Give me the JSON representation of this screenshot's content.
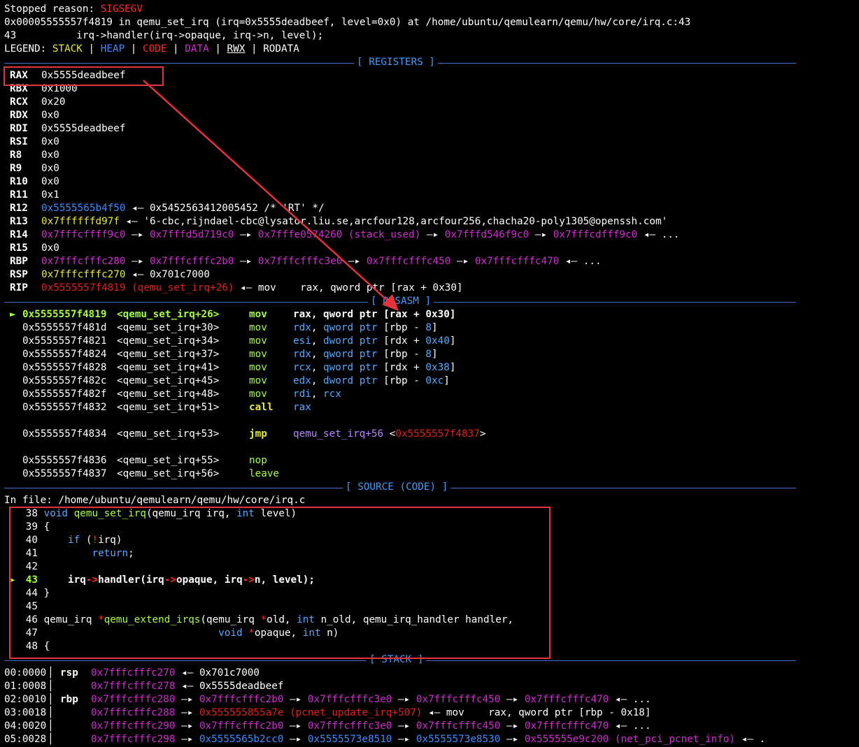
{
  "header": {
    "stopped_label": "Stopped reason: ",
    "stopped_reason": "SIGSEGV",
    "location_line": "0x00005555557f4819 in qemu_set_irq (irq=0x5555deadbeef, level=0x0) at /home/ubuntu/qemulearn/qemu/hw/core/irq.c:43",
    "source_line": "43          irq->handler(irq->opaque, irq->n, level);",
    "legend": {
      "label": "LEGEND: ",
      "stack": "STACK",
      "heap": "HEAP",
      "code": "CODE",
      "data": "DATA",
      "rwx": "RWX",
      "rodata": "RODATA",
      "sep": " | "
    }
  },
  "sections": {
    "registers": "[ REGISTERS ]",
    "disasm": "[ DISASM ]",
    "source": "[ SOURCE (CODE) ]",
    "stack": "[ STACK ]"
  },
  "registers": [
    {
      "name": "RAX",
      "value": "0x5555deadbeef"
    },
    {
      "name": "RBX",
      "value": "0x1000"
    },
    {
      "name": "RCX",
      "value": "0x20"
    },
    {
      "name": "RDX",
      "value": "0x0"
    },
    {
      "name": "RDI",
      "value": "0x5555deadbeef"
    },
    {
      "name": "RSI",
      "value": "0x0"
    },
    {
      "name": "R8",
      "value": "0x0"
    },
    {
      "name": "R9",
      "value": "0x0"
    },
    {
      "name": "R10",
      "value": "0x0"
    },
    {
      "name": "R11",
      "value": "0x1"
    },
    {
      "name": "R12",
      "p1": "0x5555565b4f50",
      "p2": " ◂— 0x5452563412005452 /* 'RT' */"
    },
    {
      "name": "R13",
      "p1": "0x7ffffffd97f",
      "p2": " ◂— '6-cbc,rijndael-cbc@lysator.liu.se,arcfour128,arcfour256,chacha20-poly1305@openssh.com'"
    },
    {
      "name": "R14",
      "chain": [
        "0x7fffcffff9c0",
        " —▸ ",
        "0x7fffd5d719c0",
        " —▸ ",
        "0x7fffe0574260 (stack_used)",
        " —▸ ",
        "0x7fffd546f9c0",
        " —▸ ",
        "0x7fffcdfff9c0",
        " ◂— ..."
      ]
    },
    {
      "name": "R15",
      "value": "0x0"
    },
    {
      "name": "RBP",
      "chain": [
        "0x7fffcfffc280",
        " —▸ ",
        "0x7fffcfffc2b0",
        " —▸ ",
        "0x7fffcfffc3e0",
        " —▸ ",
        "0x7fffcfffc450",
        " —▸ ",
        "0x7fffcfffc470",
        " ◂— ..."
      ]
    },
    {
      "name": "RSP",
      "p1": "0x7fffcfffc270",
      "p2": " ◂— 0x701c7000"
    },
    {
      "name": "RIP",
      "p1": "0x5555557f4819 (qemu_set_irq+26)",
      "p2": " ◂— mov    rax, qword ptr [rax + 0x30]"
    }
  ],
  "disasm": [
    {
      "marker": "►",
      "addr": "0x5555557f4819",
      "sym": "<qemu_set_irq+26>",
      "mn": "mov",
      "ops": [
        {
          "t": "rax",
          "c": "w"
        },
        {
          "t": ", ",
          "c": "w"
        },
        {
          "t": "qword ptr",
          "c": "w"
        },
        {
          "t": " [rax + ",
          "c": "w"
        },
        {
          "t": "0x30",
          "c": "w"
        },
        {
          "t": "]",
          "c": "w"
        }
      ],
      "current": true
    },
    {
      "addr": "0x5555557f481d",
      "sym": "<qemu_set_irq+30>",
      "mn": "mov",
      "ops": [
        {
          "t": "rdx",
          "c": "lblue"
        },
        {
          "t": ", ",
          "c": "w"
        },
        {
          "t": "qword ptr",
          "c": "lblue"
        },
        {
          "t": " [rbp - ",
          "c": "w"
        },
        {
          "t": "8",
          "c": "lblue"
        },
        {
          "t": "]",
          "c": "w"
        }
      ]
    },
    {
      "addr": "0x5555557f4821",
      "sym": "<qemu_set_irq+34>",
      "mn": "mov",
      "ops": [
        {
          "t": "esi",
          "c": "lblue"
        },
        {
          "t": ", ",
          "c": "w"
        },
        {
          "t": "dword ptr",
          "c": "lblue"
        },
        {
          "t": " [rdx + ",
          "c": "w"
        },
        {
          "t": "0x40",
          "c": "lblue"
        },
        {
          "t": "]",
          "c": "w"
        }
      ]
    },
    {
      "addr": "0x5555557f4824",
      "sym": "<qemu_set_irq+37>",
      "mn": "mov",
      "ops": [
        {
          "t": "rdx",
          "c": "lblue"
        },
        {
          "t": ", ",
          "c": "w"
        },
        {
          "t": "qword ptr",
          "c": "lblue"
        },
        {
          "t": " [rbp - ",
          "c": "w"
        },
        {
          "t": "8",
          "c": "lblue"
        },
        {
          "t": "]",
          "c": "w"
        }
      ]
    },
    {
      "addr": "0x5555557f4828",
      "sym": "<qemu_set_irq+41>",
      "mn": "mov",
      "ops": [
        {
          "t": "rcx",
          "c": "lblue"
        },
        {
          "t": ", ",
          "c": "w"
        },
        {
          "t": "qword ptr",
          "c": "lblue"
        },
        {
          "t": " [rdx + ",
          "c": "w"
        },
        {
          "t": "0x38",
          "c": "lblue"
        },
        {
          "t": "]",
          "c": "w"
        }
      ]
    },
    {
      "addr": "0x5555557f482c",
      "sym": "<qemu_set_irq+45>",
      "mn": "mov",
      "ops": [
        {
          "t": "edx",
          "c": "lblue"
        },
        {
          "t": ", ",
          "c": "w"
        },
        {
          "t": "dword ptr",
          "c": "lblue"
        },
        {
          "t": " [rbp - ",
          "c": "w"
        },
        {
          "t": "0xc",
          "c": "lblue"
        },
        {
          "t": "]",
          "c": "w"
        }
      ]
    },
    {
      "addr": "0x5555557f482f",
      "sym": "<qemu_set_irq+48>",
      "mn": "mov",
      "ops": [
        {
          "t": "rdi",
          "c": "lblue"
        },
        {
          "t": ", ",
          "c": "w"
        },
        {
          "t": "rcx",
          "c": "lblue"
        }
      ]
    },
    {
      "addr": "0x5555557f4832",
      "sym": "<qemu_set_irq+51>",
      "mn": "call",
      "ops": [
        {
          "t": "rax",
          "c": "lblue"
        }
      ],
      "bold": true
    },
    {
      "blank": true
    },
    {
      "addr": "0x5555557f4834",
      "sym": "<qemu_set_irq+53>",
      "mn": "jmp",
      "ops": [
        {
          "t": "qemu_set_irq+56",
          "c": "purp"
        },
        {
          "t": " <",
          "c": "w"
        },
        {
          "t": "0x5555557f4837",
          "c": "dred"
        },
        {
          "t": ">",
          "c": "w"
        }
      ],
      "bold": true
    },
    {
      "blank": true
    },
    {
      "addr": "0x5555557f4836",
      "sym": "<qemu_set_irq+55>",
      "mn": "nop",
      "ops": []
    },
    {
      "addr": "0x5555557f4837",
      "sym": "<qemu_set_irq+56>",
      "mn": "leave",
      "ops": []
    }
  ],
  "source": {
    "file_line": "In file: /home/ubuntu/qemulearn/qemu/hw/core/irq.c",
    "lines": [
      {
        "n": "38",
        "code": [
          {
            "t": "void ",
            "c": "lblue"
          },
          {
            "t": "qemu_set_irq",
            "c": "grn"
          },
          {
            "t": "(qemu_irq irq, ",
            "c": "w"
          },
          {
            "t": "int",
            "c": "lblue"
          },
          {
            "t": " level)",
            "c": "w"
          }
        ]
      },
      {
        "n": "39",
        "code": [
          {
            "t": "{",
            "c": "w"
          }
        ]
      },
      {
        "n": "40",
        "code": [
          {
            "t": "    if ",
            "c": "lblue"
          },
          {
            "t": "(",
            "c": "w"
          },
          {
            "t": "!",
            "c": "red"
          },
          {
            "t": "irq)",
            "c": "w"
          }
        ]
      },
      {
        "n": "41",
        "code": [
          {
            "t": "        return",
            "c": "lblue"
          },
          {
            "t": ";",
            "c": "w"
          }
        ]
      },
      {
        "n": "42",
        "code": []
      },
      {
        "n": "43",
        "code": [
          {
            "t": "    irq",
            "c": "w",
            "b": true
          },
          {
            "t": "->",
            "c": "red",
            "b": true
          },
          {
            "t": "handler(irq",
            "c": "w",
            "b": true
          },
          {
            "t": "->",
            "c": "red",
            "b": true
          },
          {
            "t": "opaque, irq",
            "c": "w",
            "b": true
          },
          {
            "t": "->",
            "c": "red",
            "b": true
          },
          {
            "t": "n, level);",
            "c": "w",
            "b": true
          }
        ],
        "current": true
      },
      {
        "n": "44",
        "code": [
          {
            "t": "}",
            "c": "w"
          }
        ]
      },
      {
        "n": "45",
        "code": []
      },
      {
        "n": "46",
        "code": [
          {
            "t": "qemu_irq ",
            "c": "w"
          },
          {
            "t": "*",
            "c": "red"
          },
          {
            "t": "qemu_extend_irqs",
            "c": "grn"
          },
          {
            "t": "(qemu_irq ",
            "c": "w"
          },
          {
            "t": "*",
            "c": "red"
          },
          {
            "t": "old, ",
            "c": "w"
          },
          {
            "t": "int",
            "c": "lblue"
          },
          {
            "t": " n_old, qemu_irq_handler handler,",
            "c": "w"
          }
        ]
      },
      {
        "n": "47",
        "code": [
          {
            "t": "                             ",
            "c": "w"
          },
          {
            "t": "void ",
            "c": "lblue"
          },
          {
            "t": "*",
            "c": "red"
          },
          {
            "t": "opaque, ",
            "c": "w"
          },
          {
            "t": "int",
            "c": "lblue"
          },
          {
            "t": " n)",
            "c": "w"
          }
        ]
      },
      {
        "n": "48",
        "code": [
          {
            "t": "{",
            "c": "w"
          }
        ]
      }
    ]
  },
  "stack": [
    {
      "off": "00:0000",
      "reg": "rsp",
      "parts": [
        {
          "t": "0x7fffcfffc270",
          "c": "mag"
        },
        {
          "t": " ◂— 0x701c7000",
          "c": "w"
        }
      ]
    },
    {
      "off": "01:0008",
      "reg": "",
      "parts": [
        {
          "t": "0x7fffcfffc278",
          "c": "mag"
        },
        {
          "t": " ◂— 0x5555deadbeef",
          "c": "w"
        }
      ]
    },
    {
      "off": "02:0010",
      "reg": "rbp",
      "parts": [
        {
          "t": "0x7fffcfffc280",
          "c": "mag"
        },
        {
          "t": " —▸ ",
          "c": "w"
        },
        {
          "t": "0x7fffcfffc2b0",
          "c": "mag"
        },
        {
          "t": " —▸ ",
          "c": "w"
        },
        {
          "t": "0x7fffcfffc3e0",
          "c": "mag"
        },
        {
          "t": " —▸ ",
          "c": "w"
        },
        {
          "t": "0x7fffcfffc450",
          "c": "mag"
        },
        {
          "t": " —▸ ",
          "c": "w"
        },
        {
          "t": "0x7fffcfffc470",
          "c": "mag"
        },
        {
          "t": " ◂— ...",
          "c": "w"
        }
      ]
    },
    {
      "off": "03:0018",
      "reg": "",
      "parts": [
        {
          "t": "0x7fffcfffc288",
          "c": "mag"
        },
        {
          "t": " —▸ ",
          "c": "w"
        },
        {
          "t": "0x555555855a7e (pcnet_update_irq+507)",
          "c": "dred"
        },
        {
          "t": " ◂— mov    rax, qword ptr [rbp - 0x18]",
          "c": "w"
        }
      ]
    },
    {
      "off": "04:0020",
      "reg": "",
      "parts": [
        {
          "t": "0x7fffcfffc290",
          "c": "mag"
        },
        {
          "t": " —▸ ",
          "c": "w"
        },
        {
          "t": "0x7fffcfffc2b0",
          "c": "mag"
        },
        {
          "t": " —▸ ",
          "c": "w"
        },
        {
          "t": "0x7fffcfffc3e0",
          "c": "mag"
        },
        {
          "t": " —▸ ",
          "c": "w"
        },
        {
          "t": "0x7fffcfffc450",
          "c": "mag"
        },
        {
          "t": " —▸ ",
          "c": "w"
        },
        {
          "t": "0x7fffcfffc470",
          "c": "mag"
        },
        {
          "t": " ◂— ...",
          "c": "w"
        }
      ]
    },
    {
      "off": "05:0028",
      "reg": "",
      "parts": [
        {
          "t": "0x7fffcfffc298",
          "c": "mag"
        },
        {
          "t": " —▸ ",
          "c": "w"
        },
        {
          "t": "0x5555565b2cc0",
          "c": "blue"
        },
        {
          "t": " —▸ ",
          "c": "w"
        },
        {
          "t": "0x5555573e8510",
          "c": "blue"
        },
        {
          "t": " —▸ ",
          "c": "w"
        },
        {
          "t": "0x5555573e8530",
          "c": "blue"
        },
        {
          "t": " —▸ ",
          "c": "w"
        },
        {
          "t": "0x555555e9c200 (net_pci_pcnet_info)",
          "c": "mag"
        },
        {
          "t": " ◂— .",
          "c": "w"
        }
      ]
    }
  ],
  "colors": {
    "annotation_red": "#e4333a",
    "separator": "#3f74c4"
  }
}
